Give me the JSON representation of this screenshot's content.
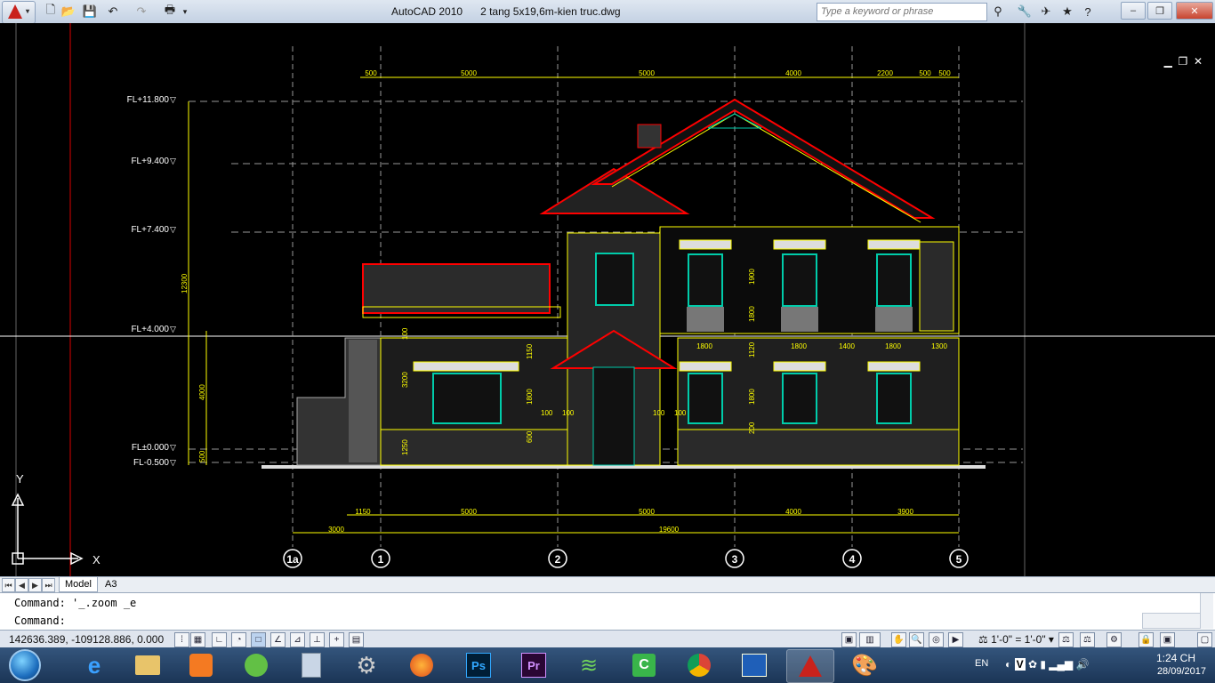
{
  "titlebar": {
    "app_name": "AutoCAD 2010",
    "file_name": "2 tang 5x19,6m-kien truc.dwg",
    "search_placeholder": "Type a keyword or phrase"
  },
  "drawing": {
    "levels": [
      "FL+11.800",
      "FL+9.400",
      "FL+7.400",
      "FL+4.000",
      "FL±0.000",
      "FL-0.500"
    ],
    "top_dims": [
      "500",
      "5000",
      "5000",
      "4000",
      "2200",
      "500",
      "500"
    ],
    "bottom_dims_row1": [
      "1150",
      "5000",
      "5000",
      "4000",
      "3900"
    ],
    "bottom_dims_row2": [
      "3000",
      "19600"
    ],
    "vertical_dims": [
      "12300",
      "4000",
      "500"
    ],
    "axes": [
      "1a",
      "1",
      "2",
      "3",
      "4",
      "5"
    ],
    "floor_dims": [
      "1800",
      "1800",
      "1400",
      "1800",
      "1300"
    ],
    "misc_dims": [
      "3200",
      "1150",
      "1800",
      "600",
      "100",
      "1250",
      "1800",
      "1900",
      "1120",
      "1800",
      "200",
      "100",
      "100",
      "100",
      "100"
    ]
  },
  "tabs": {
    "model": "Model",
    "layout": "A3"
  },
  "command": {
    "line1": "Command:  '_.zoom _e",
    "line2": "Command:"
  },
  "status": {
    "coordinates": "142636.389, -109128.886, 0.000",
    "scale": "1'-0\" = 1'-0\""
  },
  "taskbar": {
    "language": "EN",
    "time": "1:24 CH",
    "date": "28/09/2017"
  },
  "colors": {
    "background": "#000000",
    "dimension": "#ffff00",
    "roof": "#ff0000",
    "window": "#00c8a0"
  }
}
